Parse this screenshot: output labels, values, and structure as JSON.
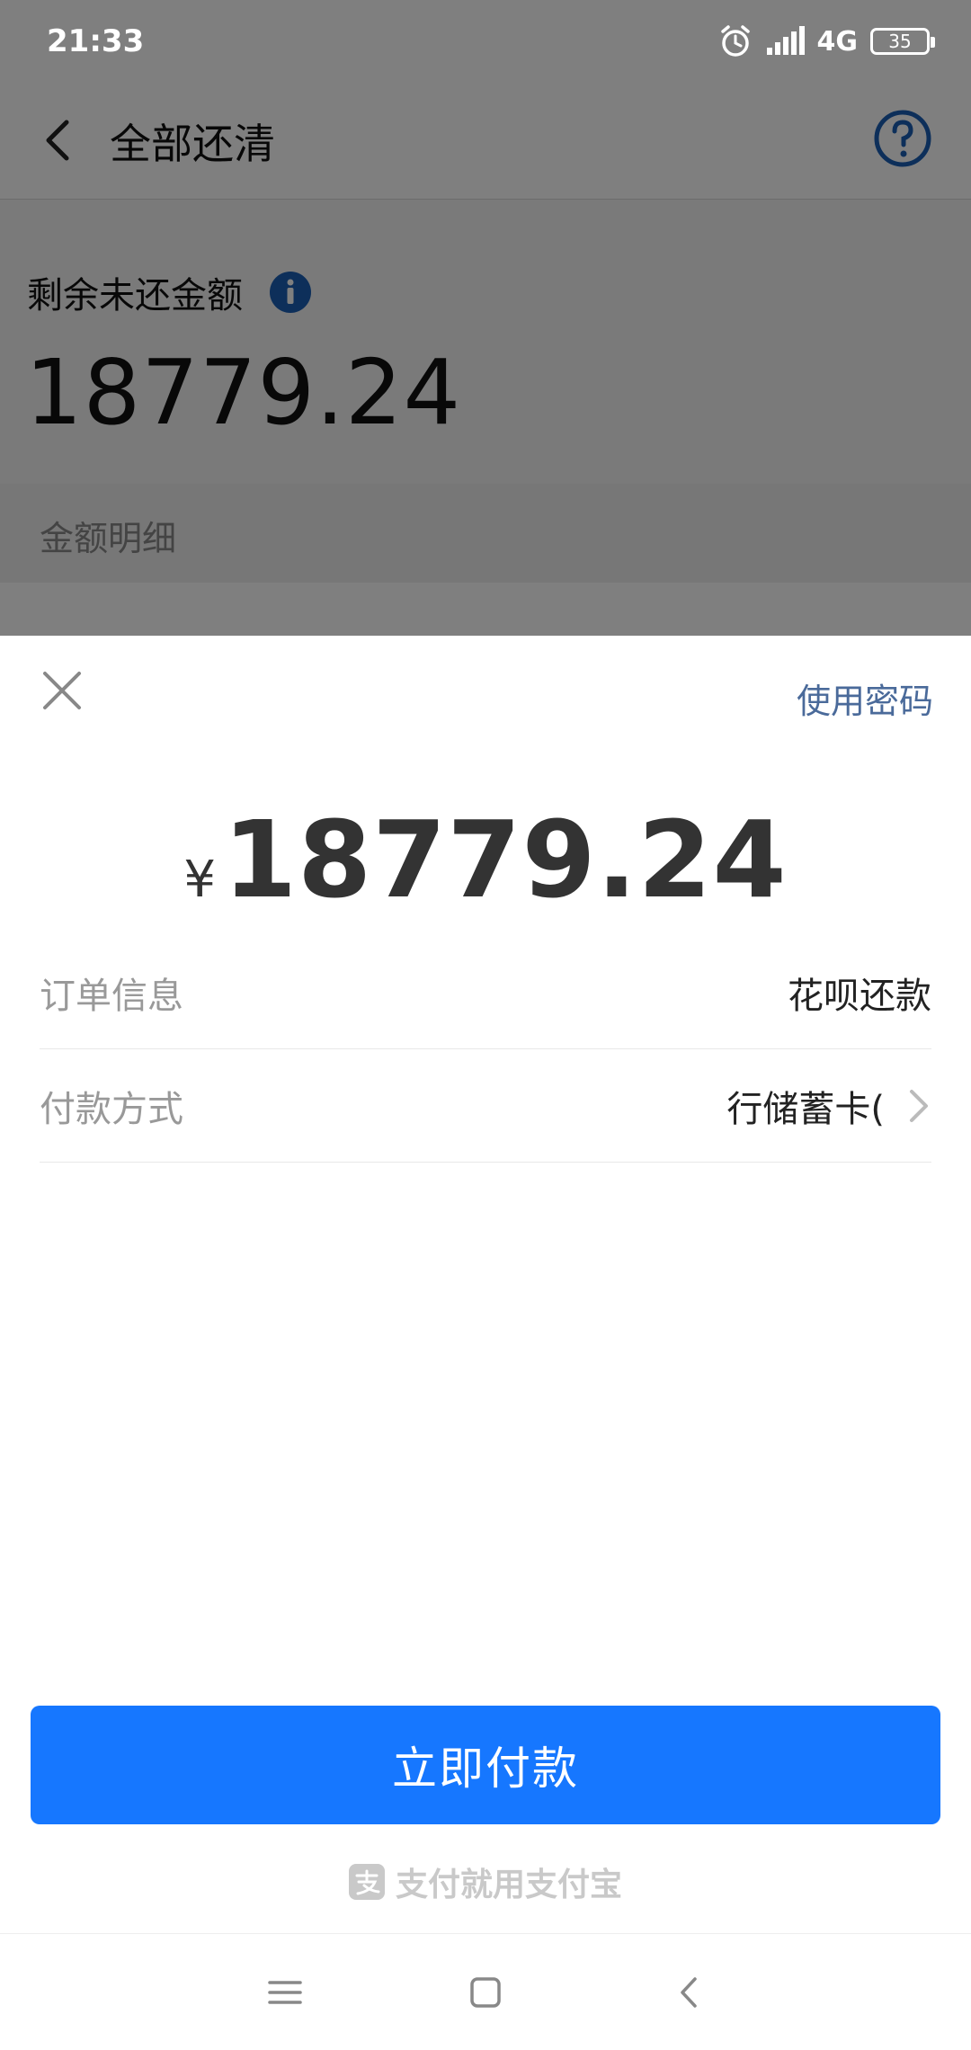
{
  "status_bar": {
    "time": "21:33",
    "network": "4G",
    "battery": "35"
  },
  "header": {
    "title": "全部还清"
  },
  "summary": {
    "remaining_label": "剩余未还金额",
    "remaining_amount": "18779.24",
    "detail_label": "金额明细"
  },
  "sheet": {
    "use_password": "使用密码",
    "currency_symbol": "¥",
    "amount": "18779.24",
    "order_label": "订单信息",
    "order_value": "花呗还款",
    "method_label": "付款方式",
    "method_value": "行储蓄卡(",
    "pay_button": "立即付款",
    "brand_slogan": "支付就用支付宝"
  },
  "colors": {
    "primary": "#1677ff",
    "link": "#4a6a9a",
    "info_icon": "#1a5fb4"
  }
}
